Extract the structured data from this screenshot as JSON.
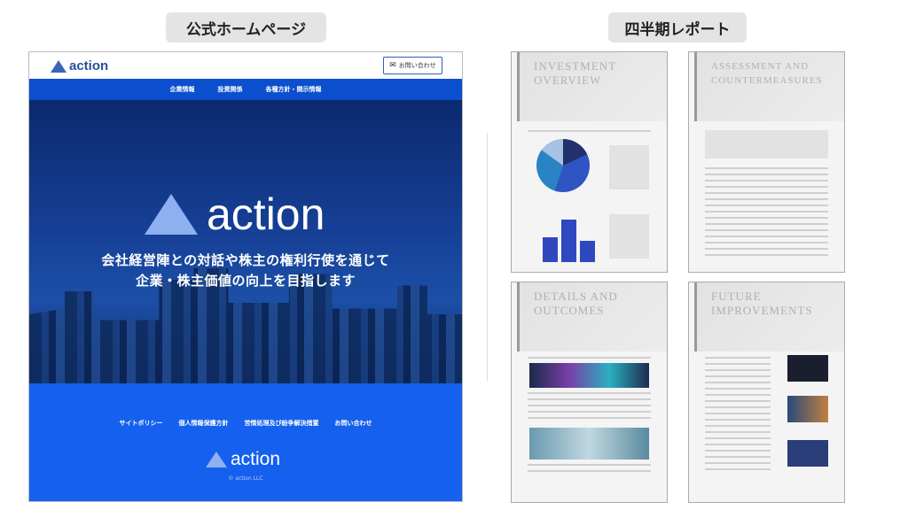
{
  "labels": {
    "homepage": "公式ホームページ",
    "report": "四半期レポート"
  },
  "site": {
    "logo": "action",
    "contact_button": "お問い合わせ",
    "nav": [
      "企業情報",
      "投資関係",
      "各種方針・開示情報"
    ],
    "hero_logo": "action",
    "tagline": [
      "会社経営陣との対話や株主の権利行使を通じて",
      "企業・株主価値の向上を目指します"
    ],
    "footer_links": [
      "サイトポリシー",
      "個人情報保護方針",
      "苦情処理及び紛争解決措置",
      "お問い合わせ"
    ],
    "footer_logo": "action",
    "copyright": "© action LLC"
  },
  "colors": {
    "nav": "#0b4fcf",
    "footer": "#1560ee",
    "brand": "#3b66b8"
  },
  "report_pages": [
    {
      "title": [
        "INVESTMENT",
        "OVERVIEW"
      ]
    },
    {
      "title": [
        "ASSESSMENT AND",
        "COUNTERMEASURES"
      ]
    },
    {
      "title": [
        "DETAILS AND",
        "OUTCOMES"
      ]
    },
    {
      "title": [
        "FUTURE",
        "IMPROVEMENTS"
      ]
    }
  ]
}
